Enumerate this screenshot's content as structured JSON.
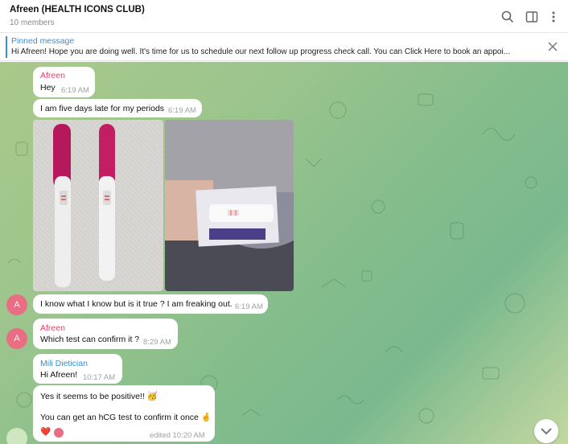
{
  "header": {
    "title": "Afreen (HEALTH ICONS CLUB)",
    "subtitle": "10 members",
    "icons": [
      "search-icon",
      "sidebar-toggle-icon",
      "more-vertical-icon"
    ]
  },
  "pinned": {
    "title": "Pinned message",
    "text": "Hi Afreen! Hope you are doing well.  It's time for us to schedule our next follow up progress check call.  You can Click Here to book an appoi...",
    "close_icon": "close-icon"
  },
  "messages": {
    "m1": {
      "sender": "Afreen",
      "text": "Hey",
      "time": "6:19 AM"
    },
    "m2": {
      "text": "I am five days late for my periods",
      "time": "6:19 AM"
    },
    "m3": {
      "text": "I know what I know but is it true ? I am freaking out.",
      "time": "6:19 AM"
    },
    "m4": {
      "sender": "Afreen",
      "text": "Which test can confirm it ?",
      "time": "8:29 AM"
    },
    "m5": {
      "sender": "Mili Dietician",
      "text": "Hi Afreen!",
      "time": "10:17 AM"
    },
    "m6": {
      "line1": "Yes it seems to be positive!! 🥳",
      "line2": "You can get an hCG test to confirm it once 🤞",
      "time": "edited 10:20 AM",
      "reaction": "❤️"
    }
  },
  "avatars": {
    "afreen_initial": "A",
    "afreen_color": "#e96d83"
  },
  "colors": {
    "accent": "#3a8ed6",
    "sender_pink": "#d9456a"
  }
}
